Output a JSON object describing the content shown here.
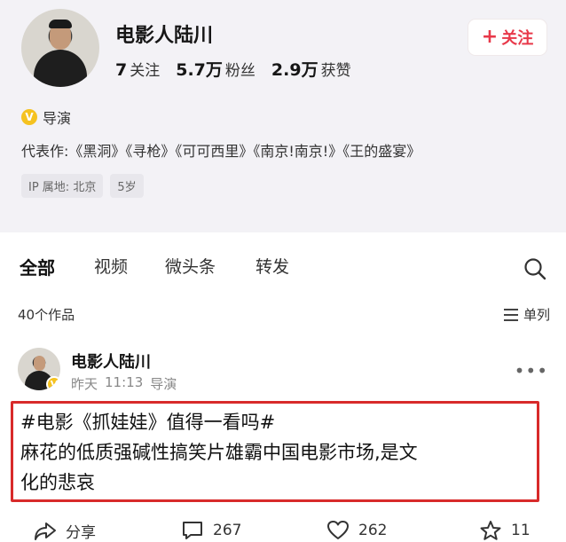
{
  "profile": {
    "name": "电影人陆川",
    "follow_label": "关注",
    "stats": [
      {
        "num": "7",
        "label": "关注"
      },
      {
        "num": "5.7万",
        "label": "粉丝"
      },
      {
        "num": "2.9万",
        "label": "获赞"
      }
    ],
    "role": "导演",
    "works": "代表作:《黑洞》《寻枪》《可可西里》《南京!南京!》《王的盛宴》",
    "chips": [
      "IP 属地: 北京",
      "5岁"
    ]
  },
  "tabs": [
    "全部",
    "视频",
    "微头条",
    "转发"
  ],
  "content": {
    "count": "40个作品",
    "layout_label": "单列"
  },
  "post": {
    "author": "电影人陆川",
    "date": "昨天",
    "time": "11:13",
    "role": "导演",
    "line1": "#电影《抓娃娃》值得一看吗#",
    "line2": "麻花的低质强碱性搞笑片雄霸中国电影市场,是文",
    "line3": "化的悲哀"
  },
  "actions": {
    "share": "分享",
    "comments": "267",
    "likes": "262",
    "favorites": "11"
  },
  "colors": {
    "accent": "#e8394a",
    "highlight_border": "#d82a2a",
    "badge": "#f5c220"
  }
}
